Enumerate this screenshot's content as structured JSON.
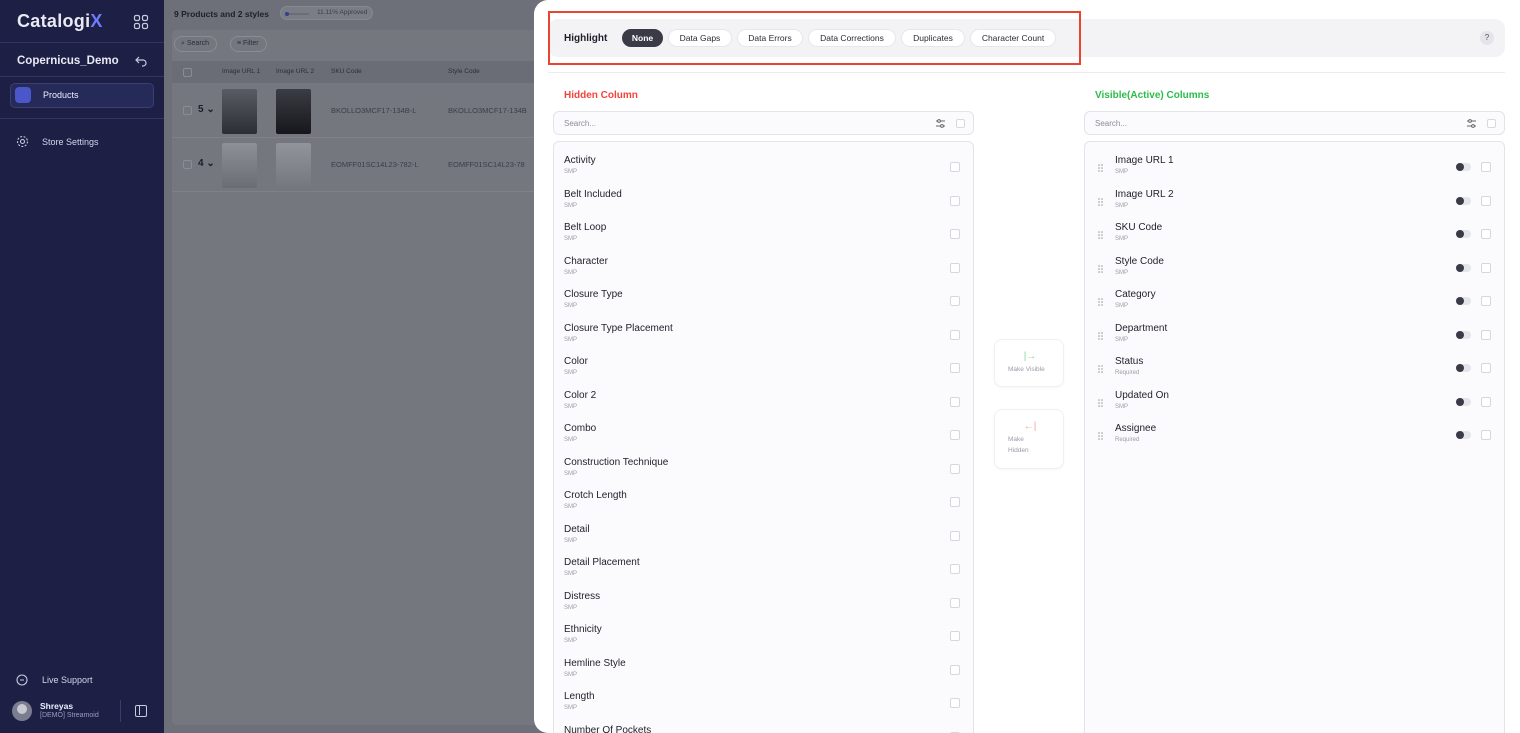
{
  "sidebar": {
    "logo_main": "Catalogi",
    "logo_accent": "X",
    "workspace": "Copernicus_Demo",
    "nav_products": "Products",
    "nav_store_settings": "Store Settings",
    "live_support": "Live Support",
    "user_name": "Shreyas",
    "user_org": "[DEMO] Streamoid"
  },
  "products_page": {
    "title": "9 Products and 2 styles",
    "approved_badge": "11.11% Approved",
    "search_label": "Search",
    "filter_label": "Filter",
    "headers": [
      "Image URL 1",
      "Image URL 2",
      "SKU Code",
      "Style Code"
    ],
    "rows": [
      {
        "count": "5",
        "sku": "BKOLLO3MCF17-134B-L",
        "style": "BKOLLO3MCF17-134B"
      },
      {
        "count": "4",
        "sku": "EOMFF01SC14L23-782-L",
        "style": "EOMFF01SC14L23-78"
      }
    ]
  },
  "highlight": {
    "label": "Highlight",
    "options": [
      "None",
      "Data Gaps",
      "Data Errors",
      "Data Corrections",
      "Duplicates",
      "Character Count"
    ],
    "selected": "None",
    "help": "?"
  },
  "hidden_columns": {
    "title": "Hidden Column",
    "search_placeholder": "Search...",
    "items": [
      {
        "name": "Activity",
        "tag": "SMP"
      },
      {
        "name": "Belt Included",
        "tag": "SMP"
      },
      {
        "name": "Belt Loop",
        "tag": "SMP"
      },
      {
        "name": "Character",
        "tag": "SMP"
      },
      {
        "name": "Closure Type",
        "tag": "SMP"
      },
      {
        "name": "Closure Type Placement",
        "tag": "SMP"
      },
      {
        "name": "Color",
        "tag": "SMP"
      },
      {
        "name": "Color 2",
        "tag": "SMP"
      },
      {
        "name": "Combo",
        "tag": "SMP"
      },
      {
        "name": "Construction Technique",
        "tag": "SMP"
      },
      {
        "name": "Crotch Length",
        "tag": "SMP"
      },
      {
        "name": "Detail",
        "tag": "SMP"
      },
      {
        "name": "Detail Placement",
        "tag": "SMP"
      },
      {
        "name": "Distress",
        "tag": "SMP"
      },
      {
        "name": "Ethnicity",
        "tag": "SMP"
      },
      {
        "name": "Hemline Style",
        "tag": "SMP"
      },
      {
        "name": "Length",
        "tag": "SMP"
      },
      {
        "name": "Number Of Pockets",
        "tag": ""
      }
    ]
  },
  "visible_columns": {
    "title": "Visible(Active) Columns",
    "search_placeholder": "Search...",
    "items": [
      {
        "name": "Image URL 1",
        "tag": "SMP"
      },
      {
        "name": "Image URL 2",
        "tag": "SMP"
      },
      {
        "name": "SKU Code",
        "tag": "SMP"
      },
      {
        "name": "Style Code",
        "tag": "SMP"
      },
      {
        "name": "Category",
        "tag": "SMP"
      },
      {
        "name": "Department",
        "tag": "SMP"
      },
      {
        "name": "Status",
        "tag": "Required"
      },
      {
        "name": "Updated On",
        "tag": "SMP"
      },
      {
        "name": "Assignee",
        "tag": "Required"
      }
    ]
  },
  "actions": {
    "make_visible": "Make Visible",
    "make_hidden_1": "Make",
    "make_hidden_2": "Hidden",
    "make_visible_icon": "|→",
    "make_hidden_icon": "←|"
  },
  "colors": {
    "hidden_title": "#f2433a",
    "visible_title": "#2bbd4a",
    "highlight_outline": "#e8442f",
    "sidebar_bg": "#1d1f45"
  }
}
